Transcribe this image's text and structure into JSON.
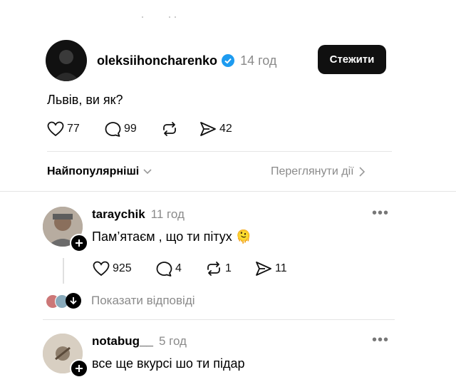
{
  "post": {
    "author": "oleksiihoncharenko",
    "time": "14 год",
    "follow_label": "Стежити",
    "text": "Львів, ви як?",
    "stats": {
      "likes": "77",
      "comments": "99",
      "shares": "42"
    }
  },
  "sort": {
    "label": "Найпопулярніші",
    "view_activity": "Переглянути дії"
  },
  "comments": [
    {
      "author": "taraychik",
      "time": "11 год",
      "text": "Пам’ятаєм , що ти пітух 🫠",
      "stats": {
        "likes": "925",
        "replies": "4",
        "reposts": "1",
        "shares": "11"
      },
      "show_replies": "Показати відповіді"
    },
    {
      "author": "notabug__",
      "time": "5 год",
      "text": "все ще вкурсі шо ти підар"
    }
  ],
  "colors": {
    "verified": "#1d9bf0",
    "button_bg": "#101010",
    "muted": "#8a8a8a"
  }
}
